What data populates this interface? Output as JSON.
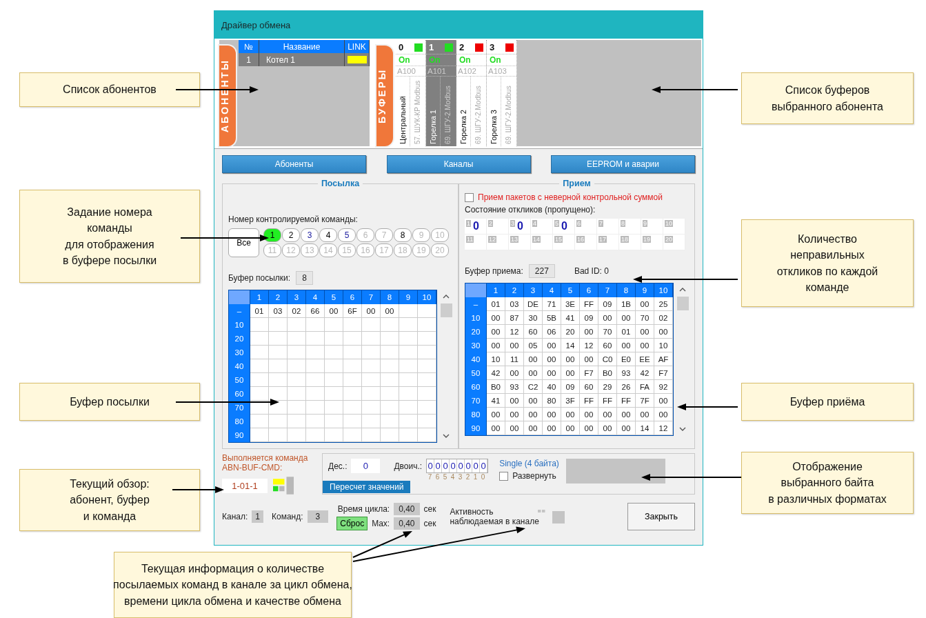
{
  "window": {
    "title": "Драйвер обмена"
  },
  "subscribers": {
    "tab": "АБОНЕНТЫ",
    "columns": [
      "№",
      "Название",
      "LINK"
    ],
    "rows": [
      {
        "number": "1",
        "name": "Котел 1",
        "color": "#ffff00",
        "selected": true
      }
    ]
  },
  "buffers": {
    "tab": "БУФЕРЫ",
    "items": [
      {
        "number": "0",
        "color": "#22dd22",
        "state": "On",
        "address": "A100",
        "name": "Центральный",
        "device": "57. ШУК-КР Modbus",
        "selected": false
      },
      {
        "number": "1",
        "color": "#22dd22",
        "state": "On",
        "address": "A101",
        "name": "Горелка 1",
        "device": "69. ШГУ-2.Modbus",
        "selected": true
      },
      {
        "number": "2",
        "color": "#ee0000",
        "state": "On",
        "address": "A102",
        "name": "Горелка 2",
        "device": "69. ШГУ-2.Modbus",
        "selected": false
      },
      {
        "number": "3",
        "color": "#ee0000",
        "state": "On",
        "address": "A103",
        "name": "Горелка 3",
        "device": "69. ШГУ-2.Modbus",
        "selected": false
      }
    ]
  },
  "nav_buttons": [
    "Абоненты",
    "Каналы",
    "EEPROM и аварии"
  ],
  "send": {
    "title": "Посылка",
    "command_label": "Номер контролируемой команды:",
    "all_button": "Все",
    "commands": [
      {
        "label": "1",
        "selected": true,
        "disabled": false,
        "kind": "plain"
      },
      {
        "label": "2",
        "selected": false,
        "disabled": false,
        "kind": "plain"
      },
      {
        "label": "3",
        "selected": false,
        "disabled": false,
        "kind": "marked"
      },
      {
        "label": "4",
        "selected": false,
        "disabled": false,
        "kind": "plain"
      },
      {
        "label": "5",
        "selected": false,
        "disabled": false,
        "kind": "marked"
      },
      {
        "label": "6",
        "selected": false,
        "disabled": true,
        "kind": "plain"
      },
      {
        "label": "7",
        "selected": false,
        "disabled": true,
        "kind": "plain"
      },
      {
        "label": "8",
        "selected": false,
        "disabled": false,
        "kind": "plain"
      },
      {
        "label": "9",
        "selected": false,
        "disabled": true,
        "kind": "plain"
      },
      {
        "label": "10",
        "selected": false,
        "disabled": true,
        "kind": "plain"
      },
      {
        "label": "11",
        "selected": false,
        "disabled": true,
        "kind": "plain"
      },
      {
        "label": "12",
        "selected": false,
        "disabled": true,
        "kind": "plain"
      },
      {
        "label": "13",
        "selected": false,
        "disabled": true,
        "kind": "plain"
      },
      {
        "label": "14",
        "selected": false,
        "disabled": true,
        "kind": "plain"
      },
      {
        "label": "15",
        "selected": false,
        "disabled": true,
        "kind": "plain"
      },
      {
        "label": "16",
        "selected": false,
        "disabled": true,
        "kind": "plain"
      },
      {
        "label": "17",
        "selected": false,
        "disabled": true,
        "kind": "plain"
      },
      {
        "label": "18",
        "selected": false,
        "disabled": true,
        "kind": "plain"
      },
      {
        "label": "19",
        "selected": false,
        "disabled": true,
        "kind": "plain"
      },
      {
        "label": "20",
        "selected": false,
        "disabled": true,
        "kind": "plain"
      }
    ],
    "buffer_label": "Буфер посылки:",
    "buffer_value": "8",
    "grid": {
      "columns": [
        "1",
        "2",
        "3",
        "4",
        "5",
        "6",
        "7",
        "8",
        "9",
        "10"
      ],
      "rows": [
        {
          "label": "–",
          "cells": [
            "01",
            "03",
            "02",
            "66",
            "00",
            "6F",
            "00",
            "00"
          ]
        },
        {
          "label": "10"
        },
        {
          "label": "20"
        },
        {
          "label": "30"
        },
        {
          "label": "40"
        },
        {
          "label": "50"
        },
        {
          "label": "60"
        },
        {
          "label": "70"
        },
        {
          "label": "80"
        },
        {
          "label": "90"
        }
      ]
    }
  },
  "receive": {
    "title": "Прием",
    "bad_checksum": {
      "label": "Прием пакетов с неверной контрольной суммой",
      "checked": false
    },
    "responses_label": "Состояние откликов (пропущено):",
    "responses": [
      {
        "label": "1",
        "value": "0"
      },
      {
        "label": "2"
      },
      {
        "label": "3",
        "value": "0"
      },
      {
        "label": "4"
      },
      {
        "label": "5",
        "value": "0"
      },
      {
        "label": "6"
      },
      {
        "label": "7"
      },
      {
        "label": "8"
      },
      {
        "label": "9"
      },
      {
        "label": "10"
      },
      {
        "label": "11"
      },
      {
        "label": "12"
      },
      {
        "label": "13"
      },
      {
        "label": "14"
      },
      {
        "label": "15"
      },
      {
        "label": "16"
      },
      {
        "label": "17"
      },
      {
        "label": "18"
      },
      {
        "label": "19"
      },
      {
        "label": "20"
      }
    ],
    "buffer_label": "Буфер приема:",
    "buffer_value": "227",
    "bad_id": "Bad ID: 0",
    "grid": {
      "columns": [
        "1",
        "2",
        "3",
        "4",
        "5",
        "6",
        "7",
        "8",
        "9",
        "10"
      ],
      "rows": [
        {
          "label": "–",
          "cells": [
            "01",
            "03",
            "DE",
            "71",
            "3E",
            "FF",
            "09",
            "1B",
            "00",
            "25"
          ]
        },
        {
          "label": "10",
          "cells": [
            "00",
            "87",
            "30",
            "5B",
            "41",
            "09",
            "00",
            "00",
            "70",
            "02"
          ]
        },
        {
          "label": "20",
          "cells": [
            "00",
            "12",
            "60",
            "06",
            "20",
            "00",
            "70",
            "01",
            "00",
            "00"
          ]
        },
        {
          "label": "30",
          "cells": [
            "00",
            "00",
            "05",
            "00",
            "14",
            "12",
            "60",
            "00",
            "00",
            "10"
          ]
        },
        {
          "label": "40",
          "cells": [
            "10",
            "11",
            "00",
            "00",
            "00",
            "00",
            "C0",
            "E0",
            "EE",
            "AF"
          ]
        },
        {
          "label": "50",
          "cells": [
            "42",
            "00",
            "00",
            "00",
            "00",
            "F7",
            "B0",
            "93",
            "42",
            "F7"
          ]
        },
        {
          "label": "60",
          "cells": [
            "B0",
            "93",
            "C2",
            "40",
            "09",
            "60",
            "29",
            "26",
            "FA",
            "92"
          ]
        },
        {
          "label": "70",
          "cells": [
            "41",
            "00",
            "00",
            "80",
            "3F",
            "FF",
            "FF",
            "FF",
            "7F",
            "00"
          ]
        },
        {
          "label": "80",
          "cells": [
            "00",
            "00",
            "00",
            "00",
            "00",
            "00",
            "00",
            "00",
            "00",
            "00"
          ]
        },
        {
          "label": "90",
          "cells": [
            "00",
            "00",
            "00",
            "00",
            "00",
            "00",
            "00",
            "00",
            "14",
            "12"
          ]
        }
      ]
    }
  },
  "running": {
    "caption": [
      "Выполняется команда",
      "ABN-BUF-CMD:"
    ],
    "value": "1-01-1"
  },
  "byte_view": {
    "decimal": {
      "label": "Дес.:",
      "value": "0"
    },
    "binary": {
      "label": "Двоич.:",
      "bits": [
        "0",
        "0",
        "0",
        "0",
        "0",
        "0",
        "0",
        "0"
      ],
      "positions": [
        "7",
        "6",
        "5",
        "4",
        "3",
        "2",
        "1",
        "0"
      ]
    },
    "recalc": "Пересчет значений",
    "format": "Single (4 байта)",
    "expand": {
      "label": "Развернуть",
      "checked": false
    }
  },
  "status": {
    "channel": {
      "label": "Канал:",
      "value": "1"
    },
    "commands": {
      "label": "Команд:",
      "value": "3"
    },
    "cycle": {
      "label": "Время цикла:",
      "value": "0,40",
      "unit": "сек"
    },
    "reset_button": "Сброс",
    "max": {
      "label": "Max:",
      "value": "0,40",
      "unit": "сек"
    },
    "activity": [
      "Активность",
      "наблюдаемая в канале"
    ],
    "close_button": "Закрыть"
  },
  "callouts": [
    {
      "lines": [
        "Список абонентов"
      ]
    },
    {
      "lines": [
        "Задание номера",
        "команды",
        "для отображения",
        "в буфере посылки"
      ]
    },
    {
      "lines": [
        "Буфер посылки"
      ]
    },
    {
      "lines": [
        "Текущий обзор:",
        "абонент, буфер",
        "и команда"
      ]
    },
    {
      "lines": [
        "Текущая информация о количестве",
        "посылаемых команд в канале за цикл обмена,",
        "времени цикла обмена и качестве обмена"
      ]
    },
    {
      "lines": [
        "Список буферов",
        "выбранного абонента"
      ]
    },
    {
      "lines": [
        "Количество",
        "неправильных",
        "откликов по каждой",
        "команде"
      ]
    },
    {
      "lines": [
        "Буфер приёма"
      ]
    },
    {
      "lines": [
        "Отображение",
        "выбранного байта",
        "в различных форматах"
      ]
    }
  ]
}
